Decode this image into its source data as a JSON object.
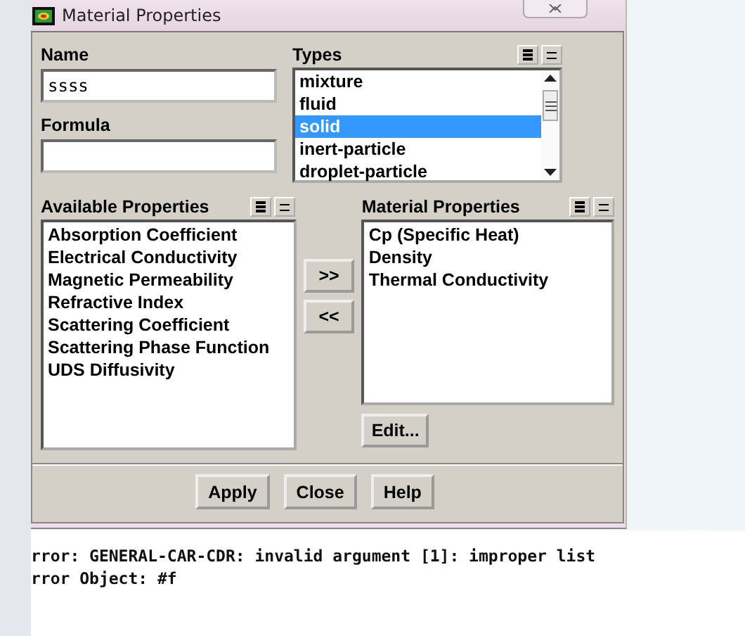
{
  "window": {
    "title": "Material Properties"
  },
  "name_field": {
    "label": "Name",
    "value": "ssss"
  },
  "formula_field": {
    "label": "Formula"
  },
  "types": {
    "label": "Types",
    "items": [
      {
        "label": "mixture",
        "selected": false
      },
      {
        "label": "fluid",
        "selected": false
      },
      {
        "label": "solid",
        "selected": true
      },
      {
        "label": "inert-particle",
        "selected": false
      },
      {
        "label": "droplet-particle",
        "selected": false
      }
    ]
  },
  "available_properties": {
    "label": "Available Properties",
    "items": [
      "Absorption Coefficient",
      "Electrical Conductivity",
      "Magnetic Permeability",
      "Refractive Index",
      "Scattering Coefficient",
      "Scattering Phase Function",
      "UDS Diffusivity"
    ]
  },
  "transfer_buttons": [
    ">>",
    "<<"
  ],
  "material_properties": {
    "label": "Material Properties",
    "items": [
      "Cp (Specific Heat)",
      "Density",
      "Thermal Conductivity"
    ]
  },
  "edit_button": "Edit...",
  "buttons": [
    "Apply",
    "Close",
    "Help"
  ],
  "console": {
    "lines": [
      "rror: GENERAL-CAR-CDR: invalid argument [1]: improper list",
      "rror Object: #f"
    ]
  }
}
